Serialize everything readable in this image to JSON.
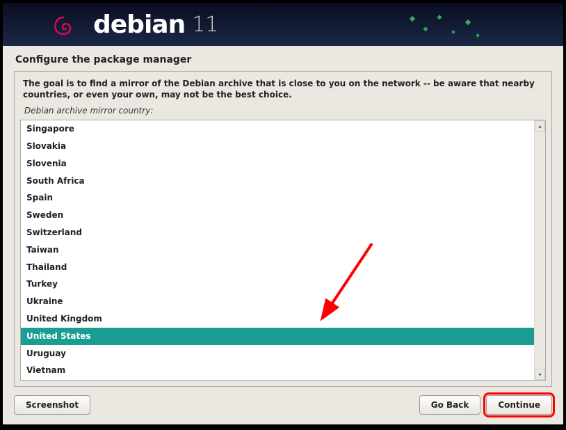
{
  "header": {
    "brand": "debian",
    "version": "11"
  },
  "page": {
    "title": "Configure the package manager",
    "description": "The goal is to find a mirror of the Debian archive that is close to you on the network -- be aware that nearby countries, or even your own, may not be the best choice.",
    "list_label": "Debian archive mirror country:"
  },
  "countries": [
    "Singapore",
    "Slovakia",
    "Slovenia",
    "South Africa",
    "Spain",
    "Sweden",
    "Switzerland",
    "Taiwan",
    "Thailand",
    "Turkey",
    "Ukraine",
    "United Kingdom",
    "United States",
    "Uruguay",
    "Vietnam"
  ],
  "selected_country": "United States",
  "buttons": {
    "screenshot": "Screenshot",
    "go_back": "Go Back",
    "continue": "Continue"
  },
  "colors": {
    "accent": "#1a9d92",
    "highlight": "#ff0000"
  }
}
